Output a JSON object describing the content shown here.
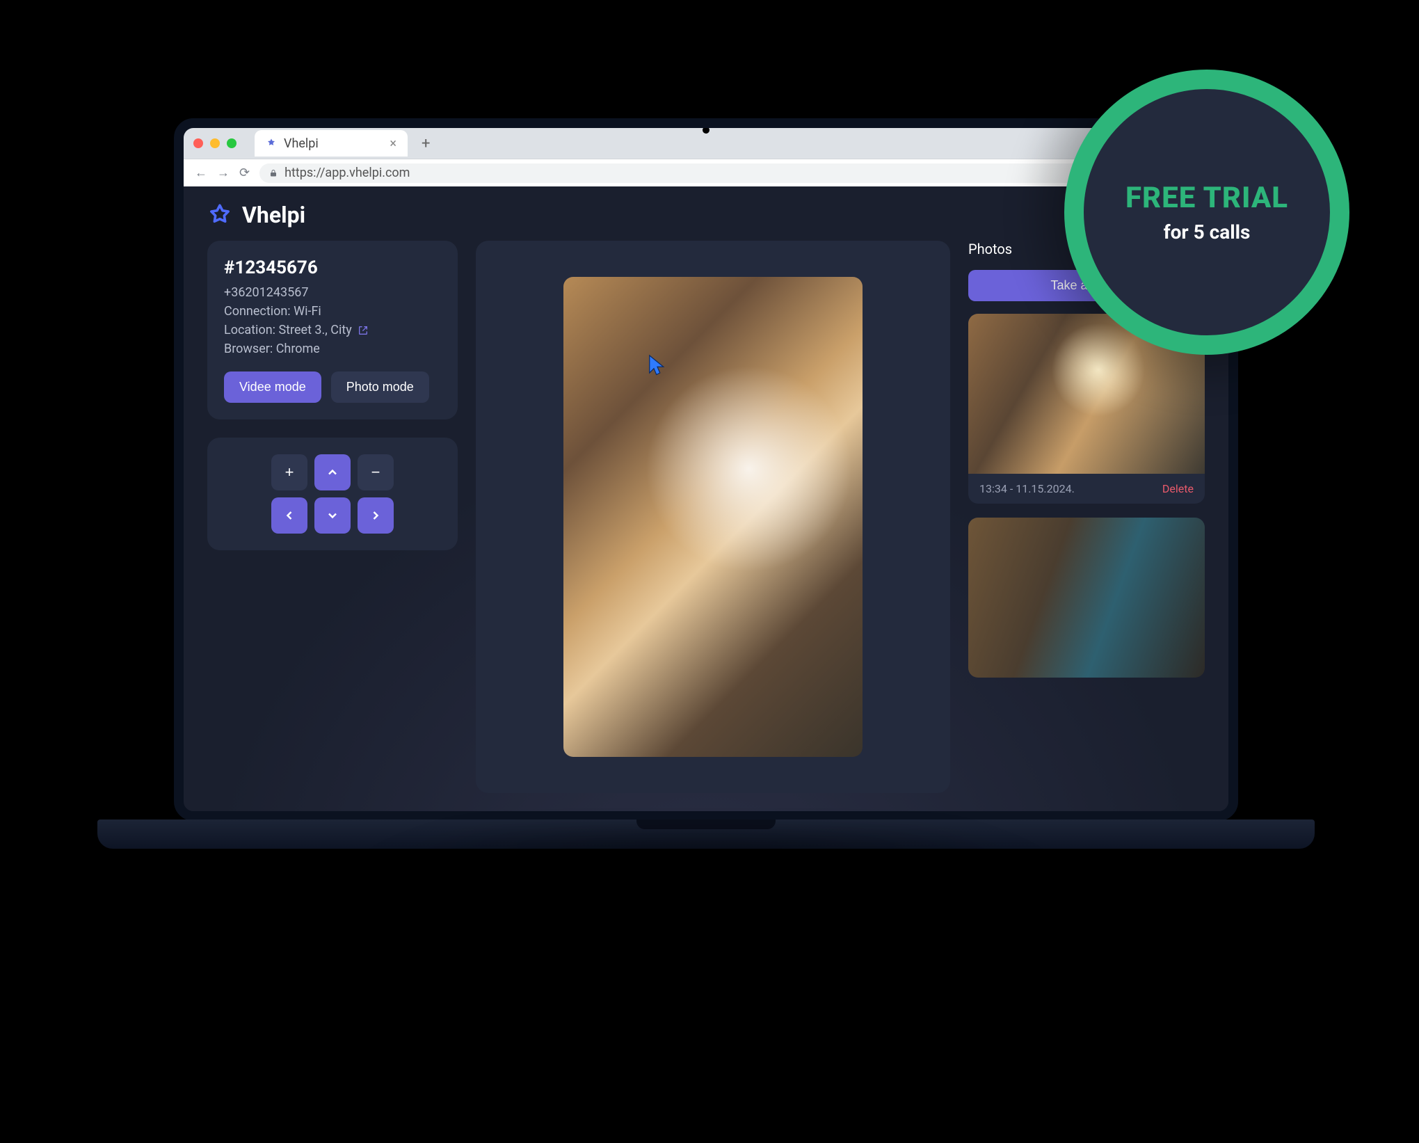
{
  "browser": {
    "tab_title": "Vhelpi",
    "url": "https://app.vhelpi.com"
  },
  "brand": {
    "name": "Vhelpi"
  },
  "session": {
    "id": "#12345676",
    "phone": "+36201243567",
    "connection": "Connection: Wi-Fi",
    "location_text": "Location: Street 3., City",
    "browser": "Browser: Chrome"
  },
  "modes": {
    "video": "Videe mode",
    "photo": "Photo mode"
  },
  "dpad": {
    "plus": "+",
    "up": "up",
    "minus": "−",
    "left": "left",
    "down": "down",
    "right": "right"
  },
  "photos": {
    "heading": "Photos",
    "take_label": "Take a photo",
    "items": [
      {
        "time": "13:34 - 11.15.2024.",
        "delete": "Delete"
      },
      {
        "time": "",
        "delete": ""
      }
    ]
  },
  "badge": {
    "title": "FREE TRIAL",
    "subtitle": "for 5 calls"
  }
}
